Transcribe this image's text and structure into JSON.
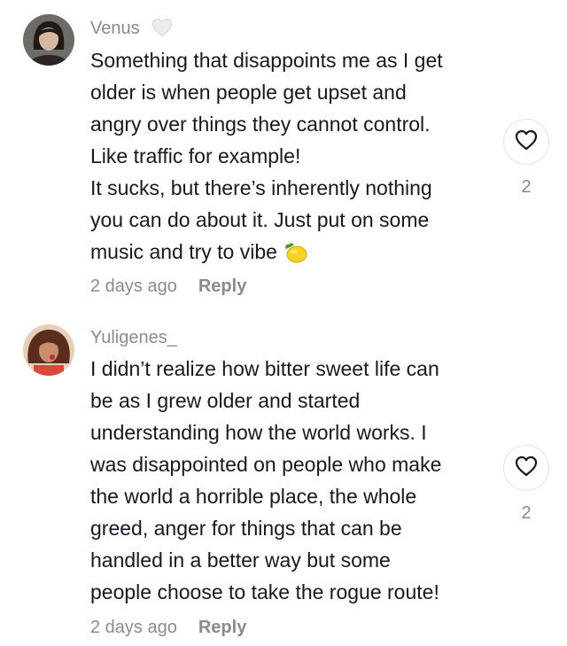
{
  "comments": [
    {
      "username": "Venus",
      "username_badge_icon": "white-heart-icon",
      "lines": [
        "Something that disappoints me as I get",
        "older is when people get upset and",
        "angry over things they cannot control.",
        "Like traffic for example!",
        "It sucks, but there’s inherently nothing",
        "you can do about it. Just put on some",
        "music and try to vibe"
      ],
      "trailing_emoji_icon": "lemon-icon",
      "timestamp": "2 days ago",
      "reply_label": "Reply",
      "like_icon": "heart-outline-icon",
      "like_count": "2"
    },
    {
      "username": "Yuligenes_",
      "lines": [
        "I didn’t realize how bitter sweet life can",
        "be as I grew older and started",
        "understanding how the world works. I",
        "was disappointed on people who make",
        "the world a horrible place, the whole",
        "greed, anger for things that can be",
        "handled in a better way but some",
        "people choose to take the rogue route!"
      ],
      "timestamp": "2 days ago",
      "reply_label": "Reply",
      "like_icon": "heart-outline-icon",
      "like_count": "2"
    }
  ]
}
